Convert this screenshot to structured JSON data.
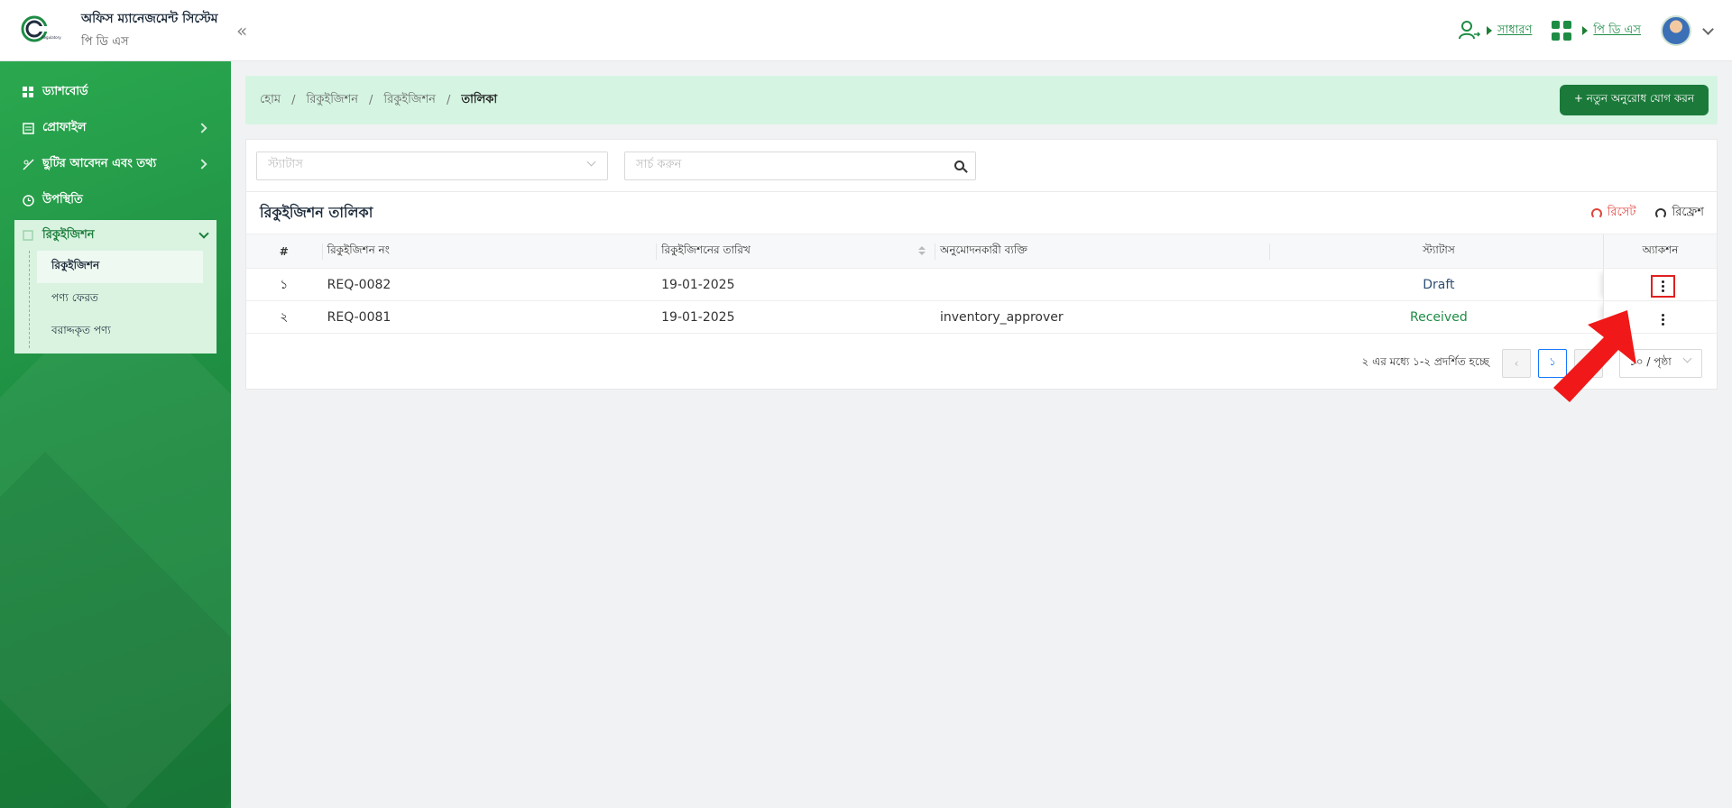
{
  "app": {
    "title": "অফিস ম্যানেজমেন্ট সিস্টেম",
    "subtitle": "পি ডি এস"
  },
  "header": {
    "role_label": "সাধারণ",
    "module_label": "পি ডি এস"
  },
  "sidebar": {
    "items": [
      {
        "label": "ড্যাশবোর্ড",
        "icon": "dashboard-icon"
      },
      {
        "label": "প্রোফাইল",
        "icon": "profile-icon"
      },
      {
        "label": "ছুটির আবেদন এবং তথ্য",
        "icon": "leave-icon"
      },
      {
        "label": "উপস্থিতি",
        "icon": "clock-icon"
      }
    ],
    "open_group": {
      "label": "রিকুইজিশন",
      "children": [
        "রিকুইজিশন",
        "পণ্য ফেরত",
        "বরাদ্দকৃত পণ্য"
      ]
    }
  },
  "breadcrumb": [
    "হোম",
    "রিকুইজিশন",
    "রিকুইজিশন",
    "তালিকা"
  ],
  "actions": {
    "new_request": "+ নতুন অনুরোধ যোগ করন"
  },
  "filters": {
    "status_placeholder": "স্ট্যাটাস",
    "search_placeholder": "সার্চ করুন"
  },
  "table": {
    "title": "রিকুইজিশন তালিকা",
    "reset": "রিসেট",
    "refresh": "রিফ্রেশ",
    "columns": [
      "#",
      "রিকুইজিশন নং",
      "রিকুইজিশনের তারিখ",
      "অনুমোদনকারী ব্যক্তি",
      "স্ট্যাটাস",
      "অ্যাকশন"
    ],
    "rows": [
      {
        "num": "১",
        "req_no": "REQ-0082",
        "date": "19-01-2025",
        "approver": "",
        "status": "Draft"
      },
      {
        "num": "২",
        "req_no": "REQ-0081",
        "date": "19-01-2025",
        "approver": "inventory_approver",
        "status": "Received"
      }
    ]
  },
  "pagination": {
    "summary": "২ এর মধ্যে ১-২ প্রদর্শিত হচ্ছে",
    "current_page": "১",
    "page_size": "১০ / পৃষ্ঠা"
  },
  "colors": {
    "brand_green": "#1b7a3a",
    "sidebar_green": "#2aa84f",
    "highlight_red": "#e02020"
  }
}
